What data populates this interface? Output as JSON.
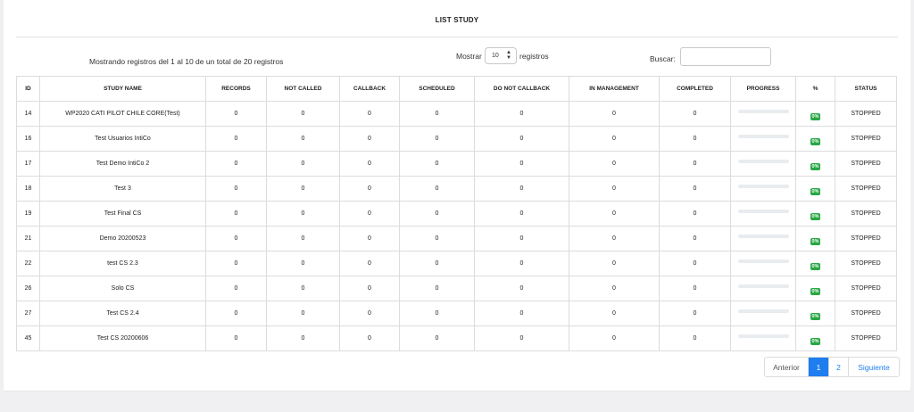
{
  "title": "LIST STUDY",
  "info_text": "Mostrando registros del 1 al 10 de un total de 20 registros",
  "length_control": {
    "label_before": "Mostrar",
    "value": "10",
    "label_after": "registros"
  },
  "search": {
    "label": "Buscar:",
    "value": "",
    "placeholder": ""
  },
  "table": {
    "headers": [
      "ID",
      "STUDY NAME",
      "RECORDS",
      "NOT CALLED",
      "CALLBACK",
      "SCHEDULED",
      "DO NOT CALLBACK",
      "IN MANAGEMENT",
      "COMPLETED",
      "PROGRESS",
      "%",
      "STATUS"
    ],
    "rows": [
      {
        "id": "14",
        "name": "WP2020 CATI PILOT CHILE CORE(Test)",
        "records": "0",
        "not_called": "0",
        "callback": "0",
        "scheduled": "0",
        "do_not_callback": "0",
        "in_management": "0",
        "completed": "0",
        "progress": 0,
        "percent": "0%",
        "status": "STOPPED"
      },
      {
        "id": "16",
        "name": "Test Usuarios IntiCo",
        "records": "0",
        "not_called": "0",
        "callback": "0",
        "scheduled": "0",
        "do_not_callback": "0",
        "in_management": "0",
        "completed": "0",
        "progress": 0,
        "percent": "0%",
        "status": "STOPPED"
      },
      {
        "id": "17",
        "name": "Test Demo IntiCo 2",
        "records": "0",
        "not_called": "0",
        "callback": "0",
        "scheduled": "0",
        "do_not_callback": "0",
        "in_management": "0",
        "completed": "0",
        "progress": 0,
        "percent": "0%",
        "status": "STOPPED"
      },
      {
        "id": "18",
        "name": "Test 3",
        "records": "0",
        "not_called": "0",
        "callback": "0",
        "scheduled": "0",
        "do_not_callback": "0",
        "in_management": "0",
        "completed": "0",
        "progress": 0,
        "percent": "0%",
        "status": "STOPPED"
      },
      {
        "id": "19",
        "name": "Test Final CS",
        "records": "0",
        "not_called": "0",
        "callback": "0",
        "scheduled": "0",
        "do_not_callback": "0",
        "in_management": "0",
        "completed": "0",
        "progress": 0,
        "percent": "0%",
        "status": "STOPPED"
      },
      {
        "id": "21",
        "name": "Demo 20200523",
        "records": "0",
        "not_called": "0",
        "callback": "0",
        "scheduled": "0",
        "do_not_callback": "0",
        "in_management": "0",
        "completed": "0",
        "progress": 0,
        "percent": "0%",
        "status": "STOPPED"
      },
      {
        "id": "22",
        "name": "test CS 2.3",
        "records": "0",
        "not_called": "0",
        "callback": "0",
        "scheduled": "0",
        "do_not_callback": "0",
        "in_management": "0",
        "completed": "0",
        "progress": 0,
        "percent": "0%",
        "status": "STOPPED"
      },
      {
        "id": "26",
        "name": "Solo CS",
        "records": "0",
        "not_called": "0",
        "callback": "0",
        "scheduled": "0",
        "do_not_callback": "0",
        "in_management": "0",
        "completed": "0",
        "progress": 0,
        "percent": "0%",
        "status": "STOPPED"
      },
      {
        "id": "27",
        "name": "Test CS 2.4",
        "records": "0",
        "not_called": "0",
        "callback": "0",
        "scheduled": "0",
        "do_not_callback": "0",
        "in_management": "0",
        "completed": "0",
        "progress": 0,
        "percent": "0%",
        "status": "STOPPED"
      },
      {
        "id": "45",
        "name": "Test CS 20200606",
        "records": "0",
        "not_called": "0",
        "callback": "0",
        "scheduled": "0",
        "do_not_callback": "0",
        "in_management": "0",
        "completed": "0",
        "progress": 0,
        "percent": "0%",
        "status": "STOPPED"
      }
    ]
  },
  "pagination": {
    "previous": "Anterior",
    "pages": [
      "1",
      "2"
    ],
    "current": "1",
    "next": "Siguiente"
  },
  "colors": {
    "primary": "#1e7ef0",
    "success": "#28a745",
    "progress_track": "#e9ecef"
  }
}
